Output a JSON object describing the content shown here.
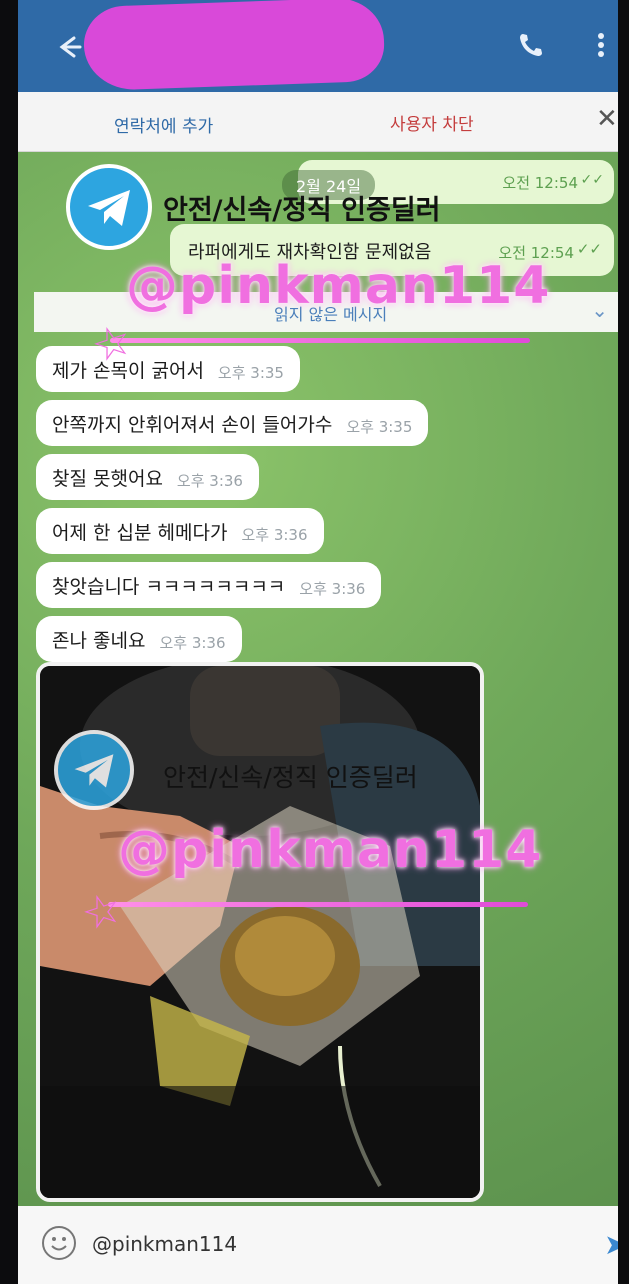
{
  "header": {
    "back_icon": "arrow-left-icon",
    "call_icon": "phone-icon",
    "menu_icon": "more-vertical-icon"
  },
  "actionbar": {
    "add_contact": "연락처에 추가",
    "block_user": "사용자 차단",
    "close_icon": "close-icon"
  },
  "chat": {
    "date": "2월 24일",
    "outgoing": [
      {
        "text": "",
        "time": "오전 12:54"
      },
      {
        "text": "라퍼에게도 재차확인함 문제없음",
        "time": "오전 12:54"
      }
    ],
    "unread_label": "읽지 않은 메시지",
    "incoming": [
      {
        "text": "제가 손목이 굵어서",
        "time": "오후 3:35"
      },
      {
        "text": "안쪽까지 안휘어져서 손이 들어가수",
        "time": "오후 3:35"
      },
      {
        "text": "찾질 못햇어요",
        "time": "오후 3:36"
      },
      {
        "text": "어제 한 십분 헤메다가",
        "time": "오후 3:36"
      },
      {
        "text": "찾앗습니다 ㅋㅋㅋㅋㅋㅋㅋㅋ",
        "time": "오후 3:36"
      },
      {
        "text": "존나 좋네요",
        "time": "오후 3:36"
      }
    ]
  },
  "watermark": {
    "tagline": "안전/신속/정직 인증딜러",
    "handle": "@pinkman114"
  },
  "input": {
    "value": "@pinkman114",
    "emoji_icon": "smiley-icon",
    "send_icon": "send-icon"
  },
  "colors": {
    "header": "#2f6aa7",
    "wallpaper": "#6fa85c",
    "outgoing_bubble": "#e6f7d3",
    "incoming_bubble": "#ffffff",
    "watermark_pink": "#f06fe0",
    "block_red": "#c43d3d"
  }
}
